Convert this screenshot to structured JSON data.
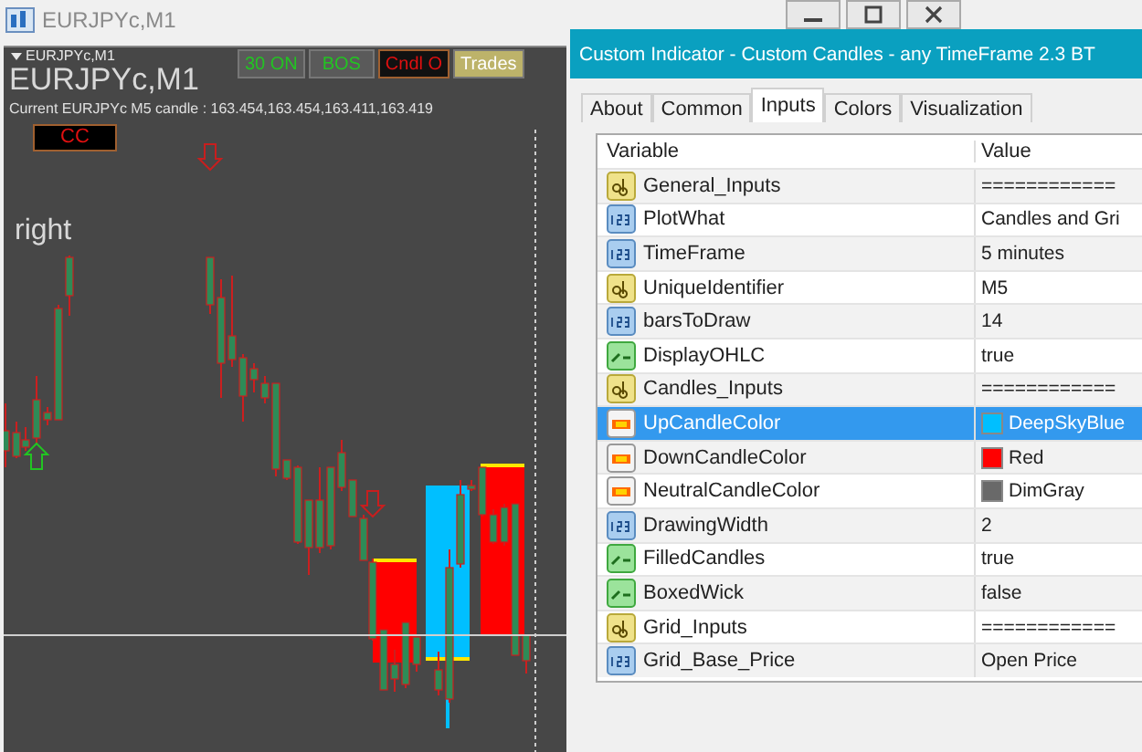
{
  "chart_window": {
    "title": "EURJPYc,M1",
    "symbol_overlay": "EURJPYc,M1",
    "symbol_small": "EURJPYc,M1",
    "candle_info": "Current EURJPYc M5 candle : 163.454,163.454,163.411,163.419",
    "buttons": [
      {
        "label": "30 ON",
        "kind": "green"
      },
      {
        "label": "BOS",
        "kind": "green"
      },
      {
        "label": "Cndl O",
        "kind": "red"
      },
      {
        "label": "Trades",
        "kind": "khaki"
      }
    ],
    "cc_label": "CC",
    "side_label": "right"
  },
  "dialog": {
    "title": "Custom Indicator - Custom Candles - any TimeFrame 2.3 BT",
    "tabs": [
      {
        "label": "About",
        "selected": false
      },
      {
        "label": "Common",
        "selected": false
      },
      {
        "label": "Inputs",
        "selected": true
      },
      {
        "label": "Colors",
        "selected": false
      },
      {
        "label": "Visualization",
        "selected": false
      }
    ],
    "columns": [
      "Variable",
      "Value"
    ],
    "rows": [
      {
        "kind": "text",
        "variable": "General_Inputs",
        "value": "============",
        "selected": false
      },
      {
        "kind": "number",
        "variable": "PlotWhat",
        "value": "Candles and Gri",
        "selected": false
      },
      {
        "kind": "number",
        "variable": "TimeFrame",
        "value": "5 minutes",
        "selected": false
      },
      {
        "kind": "text",
        "variable": "UniqueIdentifier",
        "value": "M5",
        "selected": false
      },
      {
        "kind": "number",
        "variable": "barsToDraw",
        "value": "14",
        "selected": false
      },
      {
        "kind": "bool",
        "variable": "DisplayOHLC",
        "value": "true",
        "selected": false
      },
      {
        "kind": "text",
        "variable": "Candles_Inputs",
        "value": "============",
        "selected": false
      },
      {
        "kind": "color",
        "variable": "UpCandleColor",
        "value": "DeepSkyBlue",
        "color": "#00bfff",
        "selected": true
      },
      {
        "kind": "color",
        "variable": "DownCandleColor",
        "value": "Red",
        "color": "#ff0000",
        "selected": false
      },
      {
        "kind": "color",
        "variable": "NeutralCandleColor",
        "value": "DimGray",
        "color": "#696969",
        "selected": false
      },
      {
        "kind": "number",
        "variable": "DrawingWidth",
        "value": "2",
        "selected": false
      },
      {
        "kind": "bool",
        "variable": "FilledCandles",
        "value": "true",
        "selected": false
      },
      {
        "kind": "bool",
        "variable": "BoxedWick",
        "value": "false",
        "selected": false
      },
      {
        "kind": "text",
        "variable": "Grid_Inputs",
        "value": "============",
        "selected": false
      },
      {
        "kind": "number",
        "variable": "Grid_Base_Price",
        "value": "Open Price",
        "selected": false
      }
    ]
  }
}
